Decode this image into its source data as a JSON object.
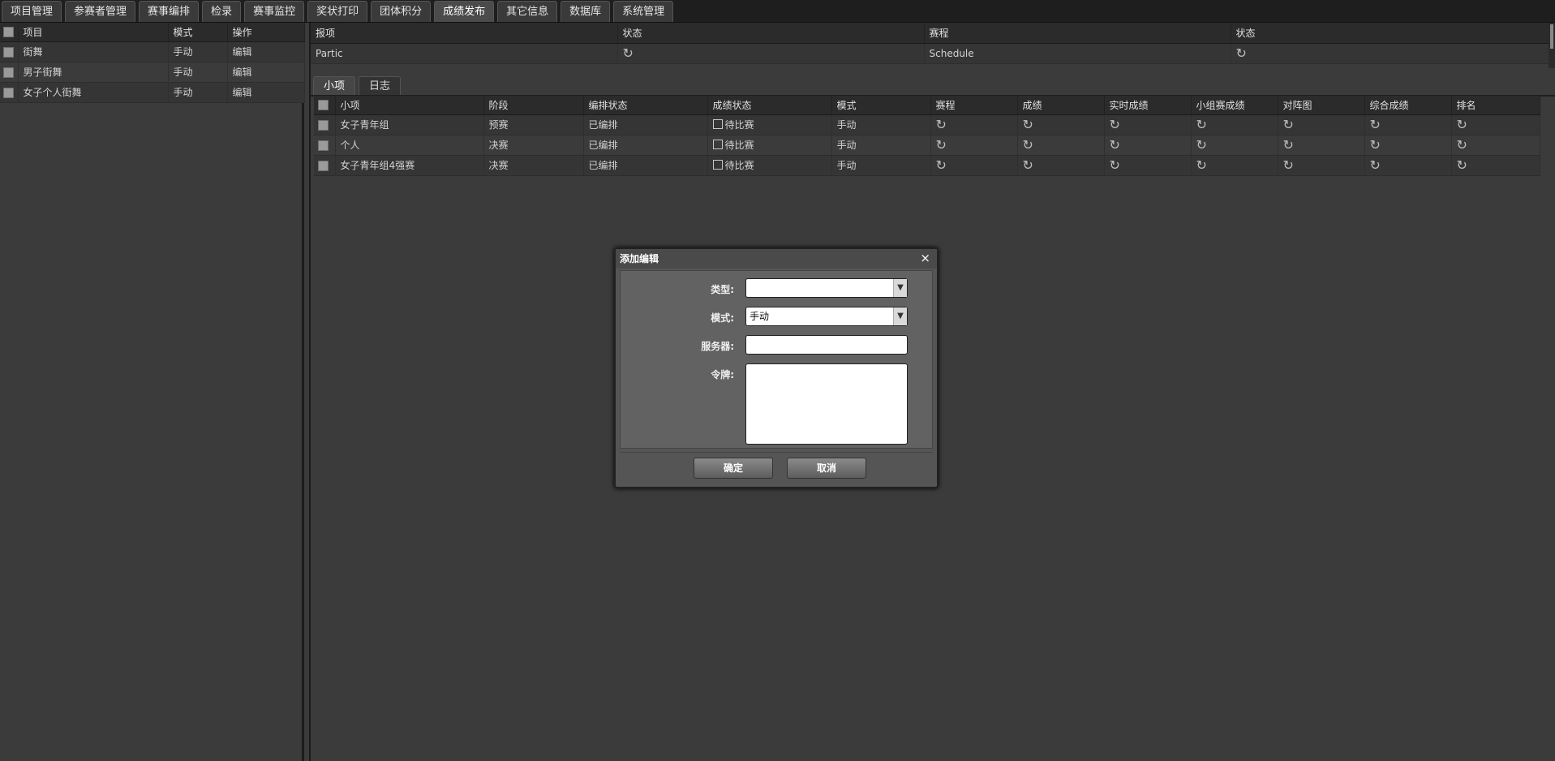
{
  "topnav": {
    "tabs": [
      "项目管理",
      "参赛者管理",
      "赛事编排",
      "检录",
      "赛事监控",
      "奖状打印",
      "团体积分",
      "成绩发布",
      "其它信息",
      "数据库",
      "系统管理"
    ],
    "active_index": 7
  },
  "left_grid": {
    "headers": [
      "项目",
      "模式",
      "操作"
    ],
    "rows": [
      {
        "name": "街舞",
        "mode": "手动",
        "op": "编辑"
      },
      {
        "name": "男子街舞",
        "mode": "手动",
        "op": "编辑"
      },
      {
        "name": "女子个人街舞",
        "mode": "手动",
        "op": "编辑"
      }
    ]
  },
  "top_grid": {
    "headers": [
      "报项",
      "状态",
      "赛程",
      "状态"
    ],
    "row": {
      "c1": "Partic",
      "c3": "Schedule"
    }
  },
  "subtabs": [
    "小项",
    "日志"
  ],
  "sub_grid": {
    "headers": [
      "小项",
      "阶段",
      "编排状态",
      "成绩状态",
      "模式",
      "赛程",
      "成绩",
      "实时成绩",
      "小组赛成绩",
      "对阵图",
      "综合成绩",
      "排名"
    ],
    "rows": [
      {
        "name": "女子青年组",
        "stage": "预赛",
        "arrange": "已编排",
        "result": "待比赛",
        "mode": "手动"
      },
      {
        "name": "个人",
        "stage": "决赛",
        "arrange": "已编排",
        "result": "待比赛",
        "mode": "手动"
      },
      {
        "name": "女子青年组4强赛",
        "stage": "决赛",
        "arrange": "已编排",
        "result": "待比赛",
        "mode": "手动"
      }
    ]
  },
  "modal": {
    "title": "添加编辑",
    "close": "×",
    "type_label": "类型:",
    "type_value": "",
    "mode_label": "模式:",
    "mode_value": "手动",
    "server_label": "服务器:",
    "token_label": "令牌:",
    "ok": "确定",
    "cancel": "取消"
  },
  "icons": {
    "refresh": "refresh-icon",
    "dropdown": "chevron-down-icon"
  }
}
